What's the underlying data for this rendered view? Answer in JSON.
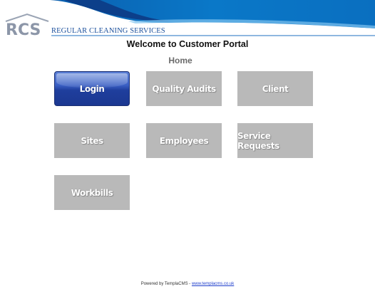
{
  "brand": {
    "logo_text": "RCS",
    "company_name": "REGULAR CLEANING SERVICES"
  },
  "page": {
    "welcome": "Welcome to Customer Portal",
    "section": "Home"
  },
  "tiles": [
    {
      "label": "Login"
    },
    {
      "label": "Quality Audits"
    },
    {
      "label": "Client"
    },
    {
      "label": "Sites"
    },
    {
      "label": "Employees"
    },
    {
      "label": "Service Requests"
    },
    {
      "label": "Workbills"
    }
  ],
  "footer": {
    "powered_by": "Powered by TemplaCMS - ",
    "link_text": "www.templacms.co.uk"
  },
  "colors": {
    "banner_blue": "#0a6fc0",
    "tile_gray": "#b9b9b9",
    "login_blue": "#1f3e9d",
    "brand_blue": "#1a4f9c"
  }
}
